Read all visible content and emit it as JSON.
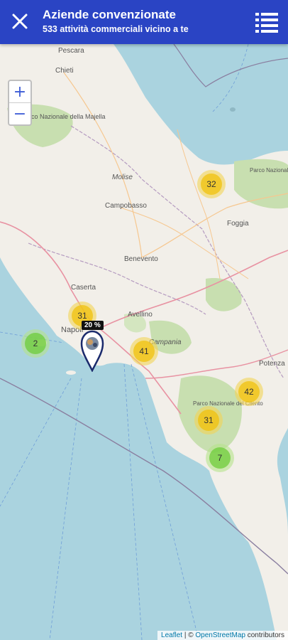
{
  "header": {
    "title": "Aziende convenzionate",
    "subtitle": "533 attività commerciali vicino a te"
  },
  "zoom": {
    "in_label": "+",
    "out_label": "−"
  },
  "clusters": [
    {
      "count": "32",
      "color": "yellow"
    },
    {
      "count": "31",
      "color": "yellow"
    },
    {
      "count": "2",
      "color": "green"
    },
    {
      "count": "41",
      "color": "yellow"
    },
    {
      "count": "42",
      "color": "yellow"
    },
    {
      "count": "31",
      "color": "yellow"
    },
    {
      "count": "7",
      "color": "green"
    }
  ],
  "marker": {
    "badge": "20 %"
  },
  "place_labels": {
    "pescara": "Pescara",
    "chieti": "Chieti",
    "parco_majella": "Parco Nazionale della Majella",
    "molise": "Molise",
    "campobasso": "Campobasso",
    "foggia": "Foggia",
    "gargano": "Parco Nazionale del Gargano",
    "benevento": "Benevento",
    "caserta": "Caserta",
    "avellino": "Avellino",
    "napoli": "Napoli",
    "campania": "Campania",
    "potenza": "Potenza",
    "cilento": "Parco Nazionale del Cilento"
  },
  "attribution": {
    "leaflet": "Leaflet",
    "separator": "| ©",
    "osm": "OpenStreetMap",
    "contributors": "contributors"
  },
  "colors": {
    "header_bg": "#2a44c4",
    "sea": "#aad3df",
    "land": "#f2efe9",
    "park": "#c8dfb0",
    "cluster_yellow": "#f0c20c",
    "cluster_green": "#6ecc39"
  }
}
